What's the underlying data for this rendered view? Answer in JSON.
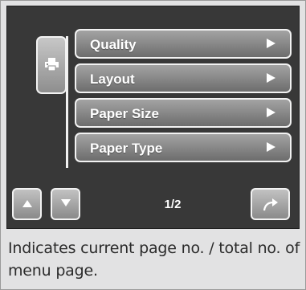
{
  "menu": {
    "items": [
      {
        "label": "Quality"
      },
      {
        "label": "Layout"
      },
      {
        "label": "Paper Size"
      },
      {
        "label": "Paper Type"
      }
    ]
  },
  "side_tab": {
    "icon": "printer-icon"
  },
  "footer": {
    "page_indicator": "1/2",
    "up_icon": "triangle-up-icon",
    "down_icon": "triangle-down-icon",
    "return_icon": "return-arrow-icon"
  },
  "caption": {
    "text": "Indicates current page no. / total no. of menu page."
  }
}
